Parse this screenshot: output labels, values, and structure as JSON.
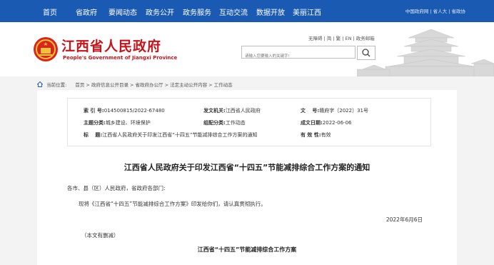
{
  "nav": {
    "items": [
      "首页",
      "省政府",
      "要闻动态",
      "政务公开",
      "政务服务",
      "互动交流",
      "数据开放",
      "美丽江西"
    ],
    "util": "中国政府网 | 省人大 | 省政协"
  },
  "header": {
    "site_title": "江西省人民政府",
    "site_subtitle": "People's Government of Jiangxi Province",
    "util_links": "无障碍 | 简 | 繁 | EN | 政务邮箱",
    "search_placeholder": "请输入您要输入的关键字!"
  },
  "breadcrumb": {
    "label": "当前位置:",
    "path": "首页 > 政府信息公开目录 > 省政府办公厅 > 法定主动公开内容 > 工作动态"
  },
  "meta": {
    "index_label": "索 引 号:",
    "index_value": "014500815/2022-67480",
    "issuer_label": "发文机关:",
    "issuer_value": "江西省人民政府",
    "docno_label": "文　 号:",
    "docno_value": "赣府字〔2022〕31号",
    "topic_label": "主题分类:",
    "topic_value": "城乡建设、环境保护",
    "org_label": "组配分类:",
    "org_value": "工作动态",
    "date_label": "成文日期:",
    "date_value": "2022-06-06",
    "title_label": "标　 题:",
    "title_value": "江西省人民政府关于印发江西省“十四五”节能减排综合工作方案的通知",
    "valid_label": "有 效 性:",
    "valid_value": "有效"
  },
  "document": {
    "title": "江西省人民政府关于印发江西省“十四五”节能减排综合工作方案的通知",
    "addressee": "各市、县（区）人民政府，省政府各部门:",
    "body": "现将《江西省“十四五”节能减排综合工作方案》印发给你们，请认真贯彻执行。",
    "date": "2022年6月6日",
    "note": "（本文有删减）",
    "plan_title": "江西省“十四五”节能减排综合工作方案"
  }
}
